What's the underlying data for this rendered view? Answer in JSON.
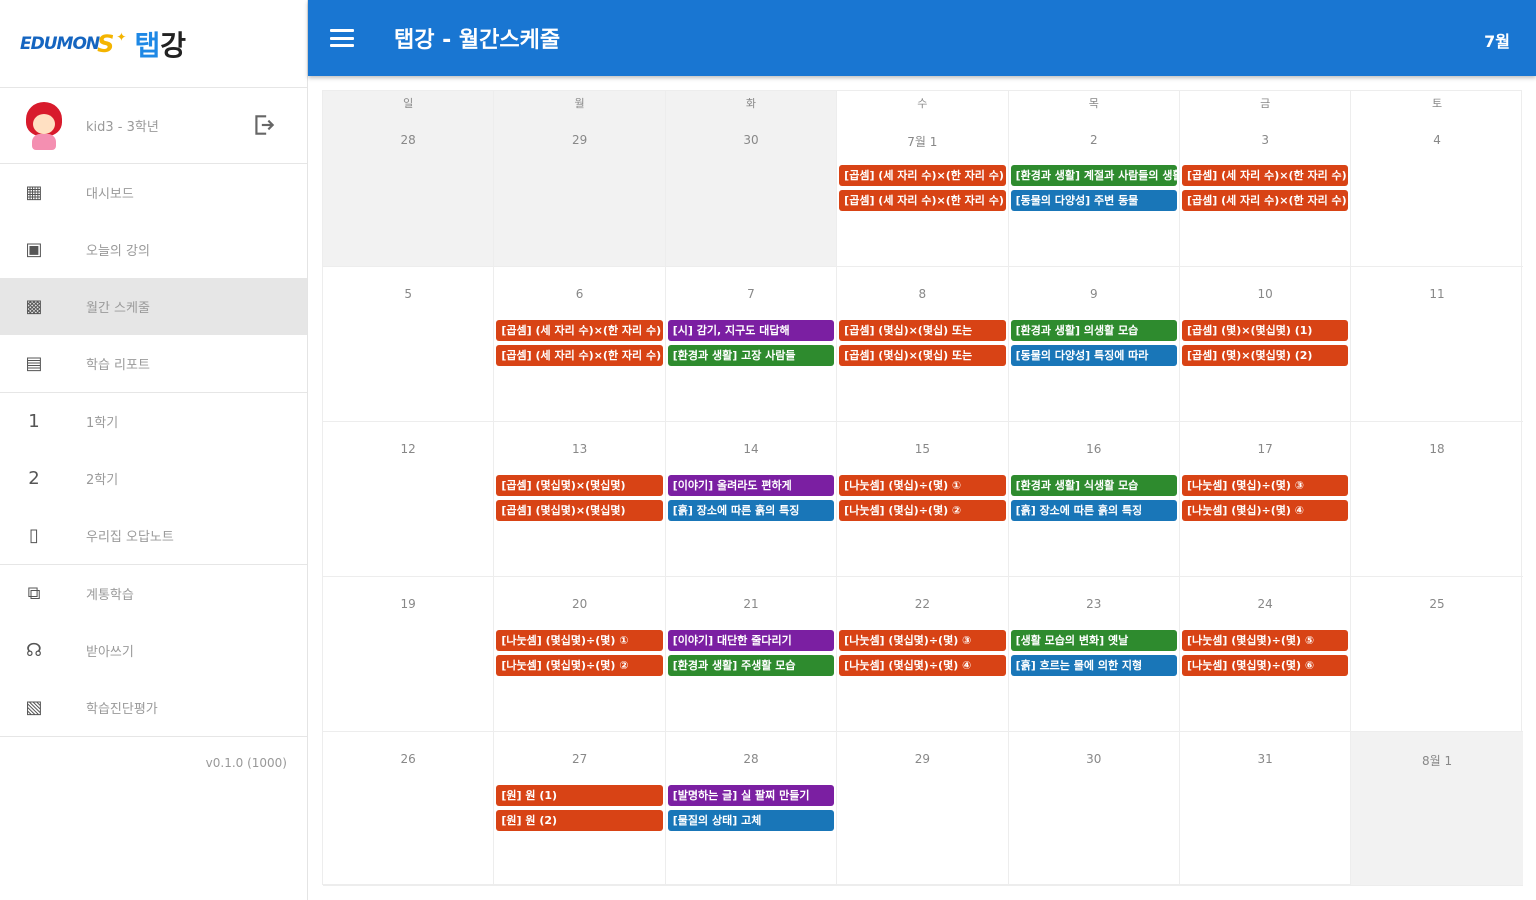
{
  "sidebar": {
    "logo": {
      "edu": "EDUMON",
      "s": "S",
      "tap": "탭",
      "gang": "강"
    },
    "profile": {
      "name": "kid3 - 3학년"
    },
    "groups": [
      [
        {
          "key": "dashboard",
          "icon": "dashboard-icon",
          "glyph": "▦",
          "label": "대시보드",
          "active": false
        },
        {
          "key": "today",
          "icon": "calendar-today-icon",
          "glyph": "▣",
          "label": "오늘의 강의",
          "active": false
        },
        {
          "key": "monthly",
          "icon": "calendar-month-icon",
          "glyph": "▩",
          "label": "월간 스케줄",
          "active": true
        },
        {
          "key": "report",
          "icon": "report-icon",
          "glyph": "▤",
          "label": "학습 리포트",
          "active": false
        }
      ],
      [
        {
          "key": "sem1",
          "icon": "semester-1-icon",
          "glyph": "1",
          "label": "1학기",
          "active": false
        },
        {
          "key": "sem2",
          "icon": "semester-2-icon",
          "glyph": "2",
          "label": "2학기",
          "active": false
        },
        {
          "key": "wrong",
          "icon": "note-icon",
          "glyph": "▯",
          "label": "우리집 오답노트",
          "active": false
        }
      ],
      [
        {
          "key": "series",
          "icon": "series-icon",
          "glyph": "⧉",
          "label": "계통학습",
          "active": false
        },
        {
          "key": "dictation",
          "icon": "dictation-icon",
          "glyph": "☊",
          "label": "받아쓰기",
          "active": false
        },
        {
          "key": "diagnosis",
          "icon": "diagnosis-icon",
          "glyph": "▧",
          "label": "학습진단평가",
          "active": false
        }
      ]
    ],
    "version": "v0.1.0 (1000)"
  },
  "topbar": {
    "title": "탭강 - 월간스케줄",
    "month": "7월"
  },
  "calendar": {
    "weekdays": [
      "일",
      "월",
      "화",
      "수",
      "목",
      "금",
      "토"
    ],
    "weeks": [
      [
        {
          "num": "28",
          "other": true,
          "events": []
        },
        {
          "num": "29",
          "other": true,
          "events": []
        },
        {
          "num": "30",
          "other": true,
          "events": []
        },
        {
          "num": "7월 1",
          "other": false,
          "events": [
            {
              "text": "[곱셈] (세 자리 수)×(한 자리 수)",
              "color": "red"
            },
            {
              "text": "[곱셈] (세 자리 수)×(한 자리 수)",
              "color": "red"
            }
          ]
        },
        {
          "num": "2",
          "other": false,
          "events": [
            {
              "text": "[환경과 생활] 계절과 사람들의 생활",
              "color": "green"
            },
            {
              "text": "[동물의 다양성] 주변 동물",
              "color": "blue"
            }
          ]
        },
        {
          "num": "3",
          "other": false,
          "events": [
            {
              "text": "[곱셈] (세 자리 수)×(한 자리 수)",
              "color": "red"
            },
            {
              "text": "[곱셈] (세 자리 수)×(한 자리 수)",
              "color": "red"
            }
          ]
        },
        {
          "num": "4",
          "other": false,
          "events": []
        }
      ],
      [
        {
          "num": "5",
          "other": false,
          "events": []
        },
        {
          "num": "6",
          "other": false,
          "events": [
            {
              "text": "[곱셈] (세 자리 수)×(한 자리 수)",
              "color": "red"
            },
            {
              "text": "[곱셈] (세 자리 수)×(한 자리 수)",
              "color": "red"
            }
          ]
        },
        {
          "num": "7",
          "other": false,
          "events": [
            {
              "text": "[시] 감기, 지구도 대답해",
              "color": "purple"
            },
            {
              "text": "[환경과 생활] 고장 사람들",
              "color": "green"
            }
          ]
        },
        {
          "num": "8",
          "other": false,
          "events": [
            {
              "text": "[곱셈] (몇십)×(몇십) 또는",
              "color": "red"
            },
            {
              "text": "[곱셈] (몇십)×(몇십) 또는",
              "color": "red"
            }
          ]
        },
        {
          "num": "9",
          "other": false,
          "events": [
            {
              "text": "[환경과 생활] 의생활 모습",
              "color": "green"
            },
            {
              "text": "[동물의 다양성] 특징에 따라",
              "color": "blue"
            }
          ]
        },
        {
          "num": "10",
          "other": false,
          "events": [
            {
              "text": "[곱셈] (몇)×(몇십몇) (1)",
              "color": "red"
            },
            {
              "text": "[곱셈] (몇)×(몇십몇) (2)",
              "color": "red"
            }
          ]
        },
        {
          "num": "11",
          "other": false,
          "events": []
        }
      ],
      [
        {
          "num": "12",
          "other": false,
          "events": []
        },
        {
          "num": "13",
          "other": false,
          "events": [
            {
              "text": "[곱셈] (몇십몇)×(몇십몇)",
              "color": "red"
            },
            {
              "text": "[곱셈] (몇십몇)×(몇십몇)",
              "color": "red"
            }
          ]
        },
        {
          "num": "14",
          "other": false,
          "events": [
            {
              "text": "[이야기] 올려라도 편하게",
              "color": "purple"
            },
            {
              "text": "[흙] 장소에 따른 흙의 특징",
              "color": "blue"
            }
          ]
        },
        {
          "num": "15",
          "other": false,
          "events": [
            {
              "text": "[나눗셈] (몇십)÷(몇) ①",
              "color": "red"
            },
            {
              "text": "[나눗셈] (몇십)÷(몇) ②",
              "color": "red"
            }
          ]
        },
        {
          "num": "16",
          "other": false,
          "events": [
            {
              "text": "[환경과 생활] 식생활 모습",
              "color": "green"
            },
            {
              "text": "[흙] 장소에 따른 흙의 특징",
              "color": "blue"
            }
          ]
        },
        {
          "num": "17",
          "other": false,
          "events": [
            {
              "text": "[나눗셈] (몇십)÷(몇) ③",
              "color": "red"
            },
            {
              "text": "[나눗셈] (몇십)÷(몇) ④",
              "color": "red"
            }
          ]
        },
        {
          "num": "18",
          "other": false,
          "events": []
        }
      ],
      [
        {
          "num": "19",
          "other": false,
          "events": []
        },
        {
          "num": "20",
          "other": false,
          "events": [
            {
              "text": "[나눗셈] (몇십몇)÷(몇) ①",
              "color": "red"
            },
            {
              "text": "[나눗셈] (몇십몇)÷(몇) ②",
              "color": "red"
            }
          ]
        },
        {
          "num": "21",
          "other": false,
          "events": [
            {
              "text": "[이야기] 대단한 줄다리기",
              "color": "purple"
            },
            {
              "text": "[환경과 생활] 주생활 모습",
              "color": "green"
            }
          ]
        },
        {
          "num": "22",
          "other": false,
          "events": [
            {
              "text": "[나눗셈] (몇십몇)÷(몇) ③",
              "color": "red"
            },
            {
              "text": "[나눗셈] (몇십몇)÷(몇) ④",
              "color": "red"
            }
          ]
        },
        {
          "num": "23",
          "other": false,
          "events": [
            {
              "text": "[생활 모습의 변화] 옛날",
              "color": "green"
            },
            {
              "text": "[흙] 흐르는 물에 의한 지형",
              "color": "blue"
            }
          ]
        },
        {
          "num": "24",
          "other": false,
          "events": [
            {
              "text": "[나눗셈] (몇십몇)÷(몇) ⑤",
              "color": "red"
            },
            {
              "text": "[나눗셈] (몇십몇)÷(몇) ⑥",
              "color": "red"
            }
          ]
        },
        {
          "num": "25",
          "other": false,
          "events": []
        }
      ],
      [
        {
          "num": "26",
          "other": false,
          "events": []
        },
        {
          "num": "27",
          "other": false,
          "events": [
            {
              "text": "[원] 원 (1)",
              "color": "red"
            },
            {
              "text": "[원] 원 (2)",
              "color": "red"
            }
          ]
        },
        {
          "num": "28",
          "other": false,
          "events": [
            {
              "text": "[발명하는 글] 실 팔찌 만들기",
              "color": "purple"
            },
            {
              "text": "[물질의 상태] 고체",
              "color": "blue"
            }
          ]
        },
        {
          "num": "29",
          "other": false,
          "events": []
        },
        {
          "num": "30",
          "other": false,
          "events": []
        },
        {
          "num": "31",
          "other": false,
          "events": []
        },
        {
          "num": "8월 1",
          "other": true,
          "events": []
        }
      ]
    ]
  }
}
